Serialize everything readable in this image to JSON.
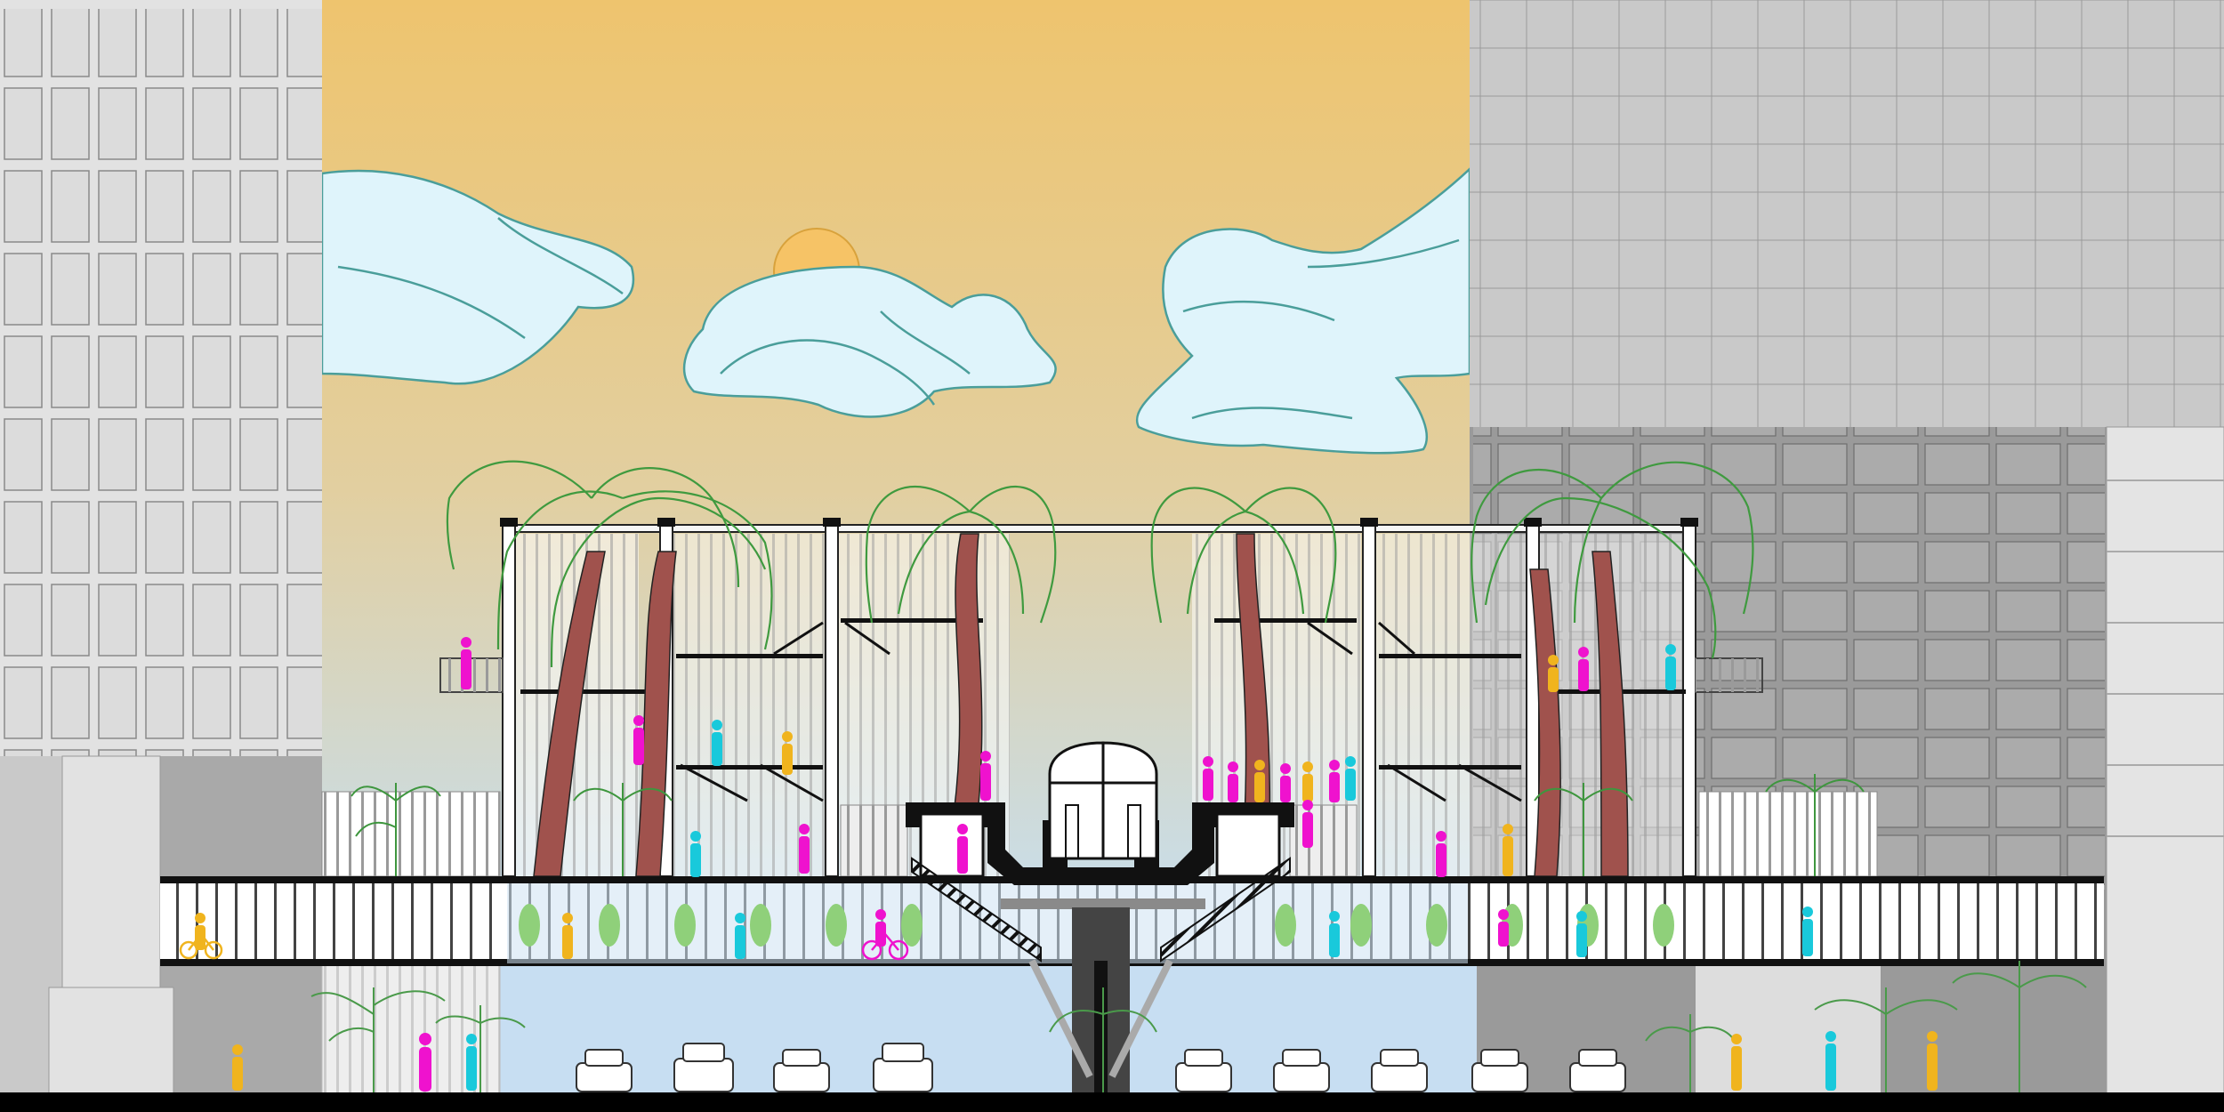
{
  "image": {
    "kind": "architectural section drawing",
    "text_labels": []
  },
  "palette": {
    "sky_top": "#eec46e",
    "sky_bottom": "#c9dde8",
    "cloud_fill": "#dff4fb",
    "cloud_stroke": "#4a9e9a",
    "sun": "#f6c366",
    "building_light": "#e2e2e2",
    "building_mid": "#c9c9c9",
    "building_dark": "#a9a9a9",
    "structure": "#111111",
    "slab_white": "#ffffff",
    "under_bridge": "#c7def2",
    "tree_green": "#3f9a3f",
    "trunk": "#a0524d",
    "people_magenta": "#ef12ce",
    "people_cyan": "#19c9db",
    "people_yellow": "#f0b41e",
    "shrub_green": "#8fd07a",
    "ground": "#000000"
  },
  "elements": {
    "clouds": 4,
    "palm_trees": 5,
    "parked_cars": 10,
    "pedestrians": 40
  }
}
